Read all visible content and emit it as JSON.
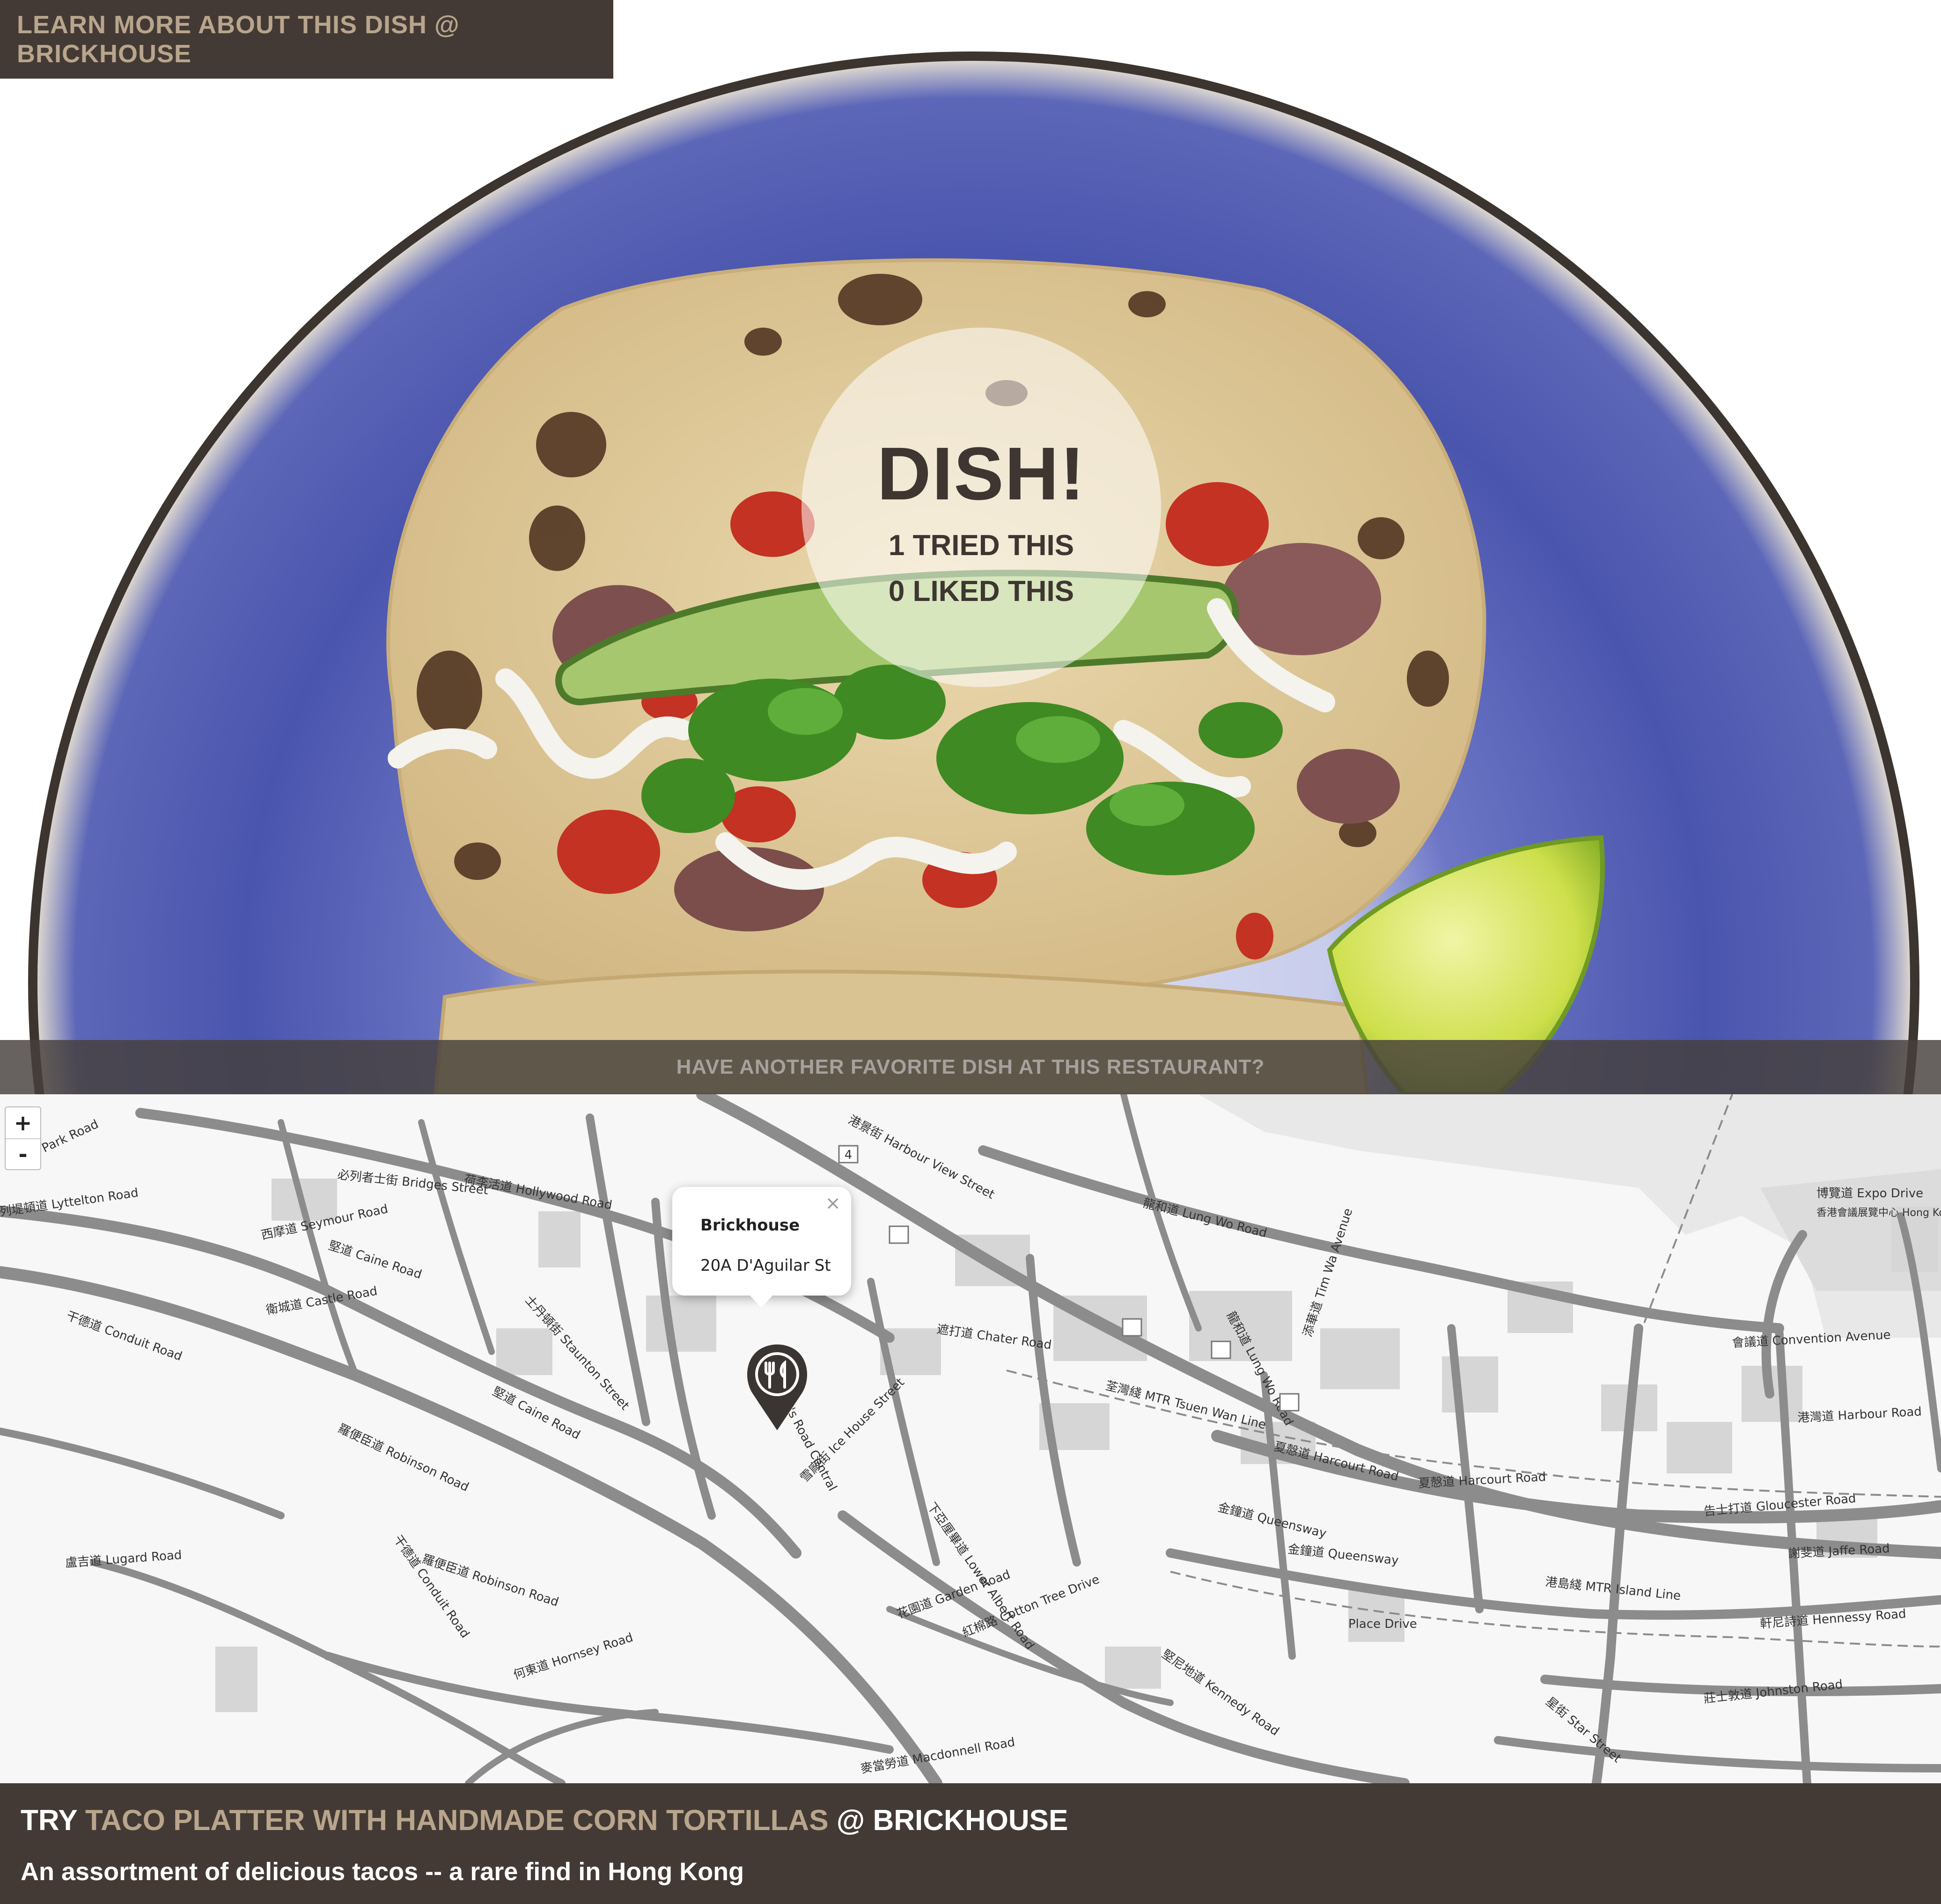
{
  "header": {
    "learn_more_label": "LEARN MORE ABOUT THIS DISH @ BRICKHOUSE"
  },
  "badge": {
    "title": "DISH!",
    "tried_count": "1",
    "tried_label": " TRIED THIS",
    "liked_count": "0",
    "liked_label": " LIKED THIS"
  },
  "another_dish_label": "HAVE ANOTHER FAVORITE DISH AT THIS RESTAURANT?",
  "map": {
    "zoom_in_label": "+",
    "zoom_out_label": "-",
    "popup": {
      "name": "Brickhouse",
      "address": "20A D'Aguilar St",
      "close_label": "×"
    },
    "street_labels": {
      "queens_road_central": "Queen's Road Central",
      "hollywood_road": "荷李活道 Hollywood Road",
      "caine_road": "堅道 Caine Road",
      "robinson_road": "羅便臣道 Robinson Road",
      "conduit_road": "干德道 Conduit Road",
      "lung_wo_road": "龍和道 Lung Wo Road",
      "chater_road": "遮打道 Chater Road",
      "harcourt_road": "夏慤道 Harcourt Road",
      "queensway": "金鐘道 Queensway",
      "convention_avenue": "會議道 Convention Avenue",
      "harbour_road": "港灣道 Harbour Road",
      "gloucester_road": "告士打道 Gloucester Road",
      "jaffe_road": "謝斐道 Jaffe Road",
      "hennessy_road": "軒尼詩道 Hennessy Road",
      "johnston_road": "莊士敦道 Johnston Road",
      "cotton_tree_drive": "紅棉路 Cotton Tree Drive",
      "garden_road": "花園道 Garden Road",
      "kennedy_road": "堅尼地道 Kennedy Road",
      "lugard_road": "盧吉道 Lugard Road",
      "harbour_view_street": "港景街 Harbour View Street",
      "staunton_street": "士丹頓街 Staunton Street",
      "castle_road": "衛城道 Castle Road",
      "bridges_street": "必列者士街 Bridges Street",
      "ice_house_street": "雪廠街 Ice House Street",
      "lower_albert_road": "下亞厘畢道 Lower Albert Road",
      "macdonnell_road": "麥當勞道 Macdonnell Road",
      "tim_wa_avenue": "添華道 Tim Wa Avenue",
      "expo_drive": "博覽道 Expo Drive",
      "convention_centre": "香港會議展覽中心 Hong Kong Convention and Exhibition Centre",
      "place_drive": "Place Drive",
      "star_street": "星街 Star Street",
      "hornsey_road": "何東道 Hornsey Road",
      "seymour_road": "西摩道 Seymour Road",
      "park_road": "柏道 Park Road",
      "lyttelton_road": "列堤頓道 Lyttelton Road",
      "tsuen_wan_line": "荃灣綫 MTR Tsuen Wan Line",
      "island_line": "港島綫 MTR Island Line",
      "route_4": "4"
    }
  },
  "footer": {
    "try_label": "TRY ",
    "dish_name": "TACO PLATTER WITH HANDMADE CORN TORTILLAS",
    "at_label": " @ ",
    "restaurant_name": "BRICKHOUSE",
    "description": "An assortment of delicious tacos -- a rare find in Hong Kong"
  },
  "colors": {
    "bar_background": "#443a35",
    "accent_tan": "#b8a58c",
    "plate_blue": "#4e5ab0",
    "road_gray": "#8c8c8c"
  }
}
